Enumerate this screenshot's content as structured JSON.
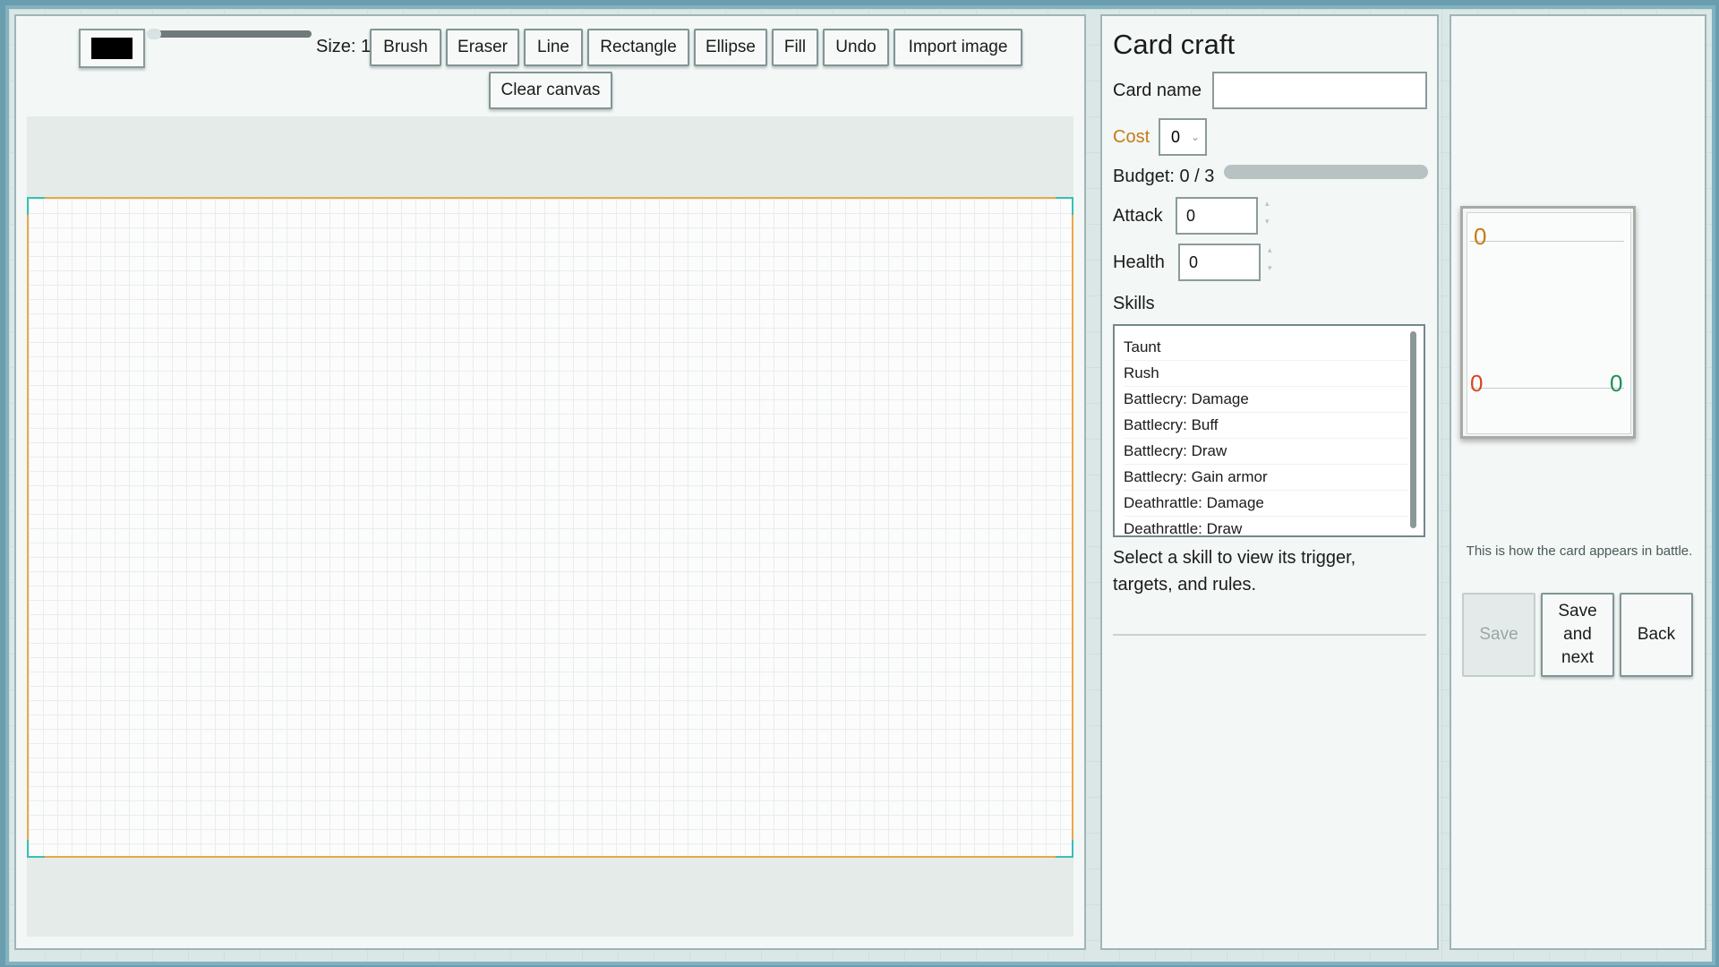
{
  "toolbar": {
    "size_label": "Size: 1",
    "color_value": "#000000",
    "buttons": [
      "Brush",
      "Eraser",
      "Line",
      "Rectangle",
      "Ellipse",
      "Fill",
      "Undo",
      "Import image"
    ],
    "clear_label": "Clear canvas"
  },
  "editor": {
    "title": "Card craft",
    "card_name_label": "Card name",
    "card_name_value": "",
    "cost_label": "Cost",
    "cost_value": "0",
    "budget_label": "Budget: 0 / 3",
    "budget_fraction": 0,
    "attack_label": "Attack",
    "attack_value": "0",
    "health_label": "Health",
    "health_value": "0",
    "skills_label": "Skills",
    "skills": [
      "Taunt",
      "Rush",
      "Battlecry: Damage",
      "Battlecry: Buff",
      "Battlecry: Draw",
      "Battlecry: Gain armor",
      "Deathrattle: Damage",
      "Deathrattle: Draw"
    ],
    "skill_hint": "Select a skill to view its trigger, targets, and rules."
  },
  "preview": {
    "cost": "0",
    "attack": "0",
    "health": "0",
    "note": "This is how the card appears in battle.",
    "save_label": "Save",
    "save_next_label": "Save and next",
    "back_label": "Back"
  },
  "colors": {
    "cost": "#c77a16",
    "attack": "#d9442b",
    "health": "#1f8f57",
    "canvas_border": "#e8a84a",
    "canvas_corner": "#39c0b3"
  }
}
